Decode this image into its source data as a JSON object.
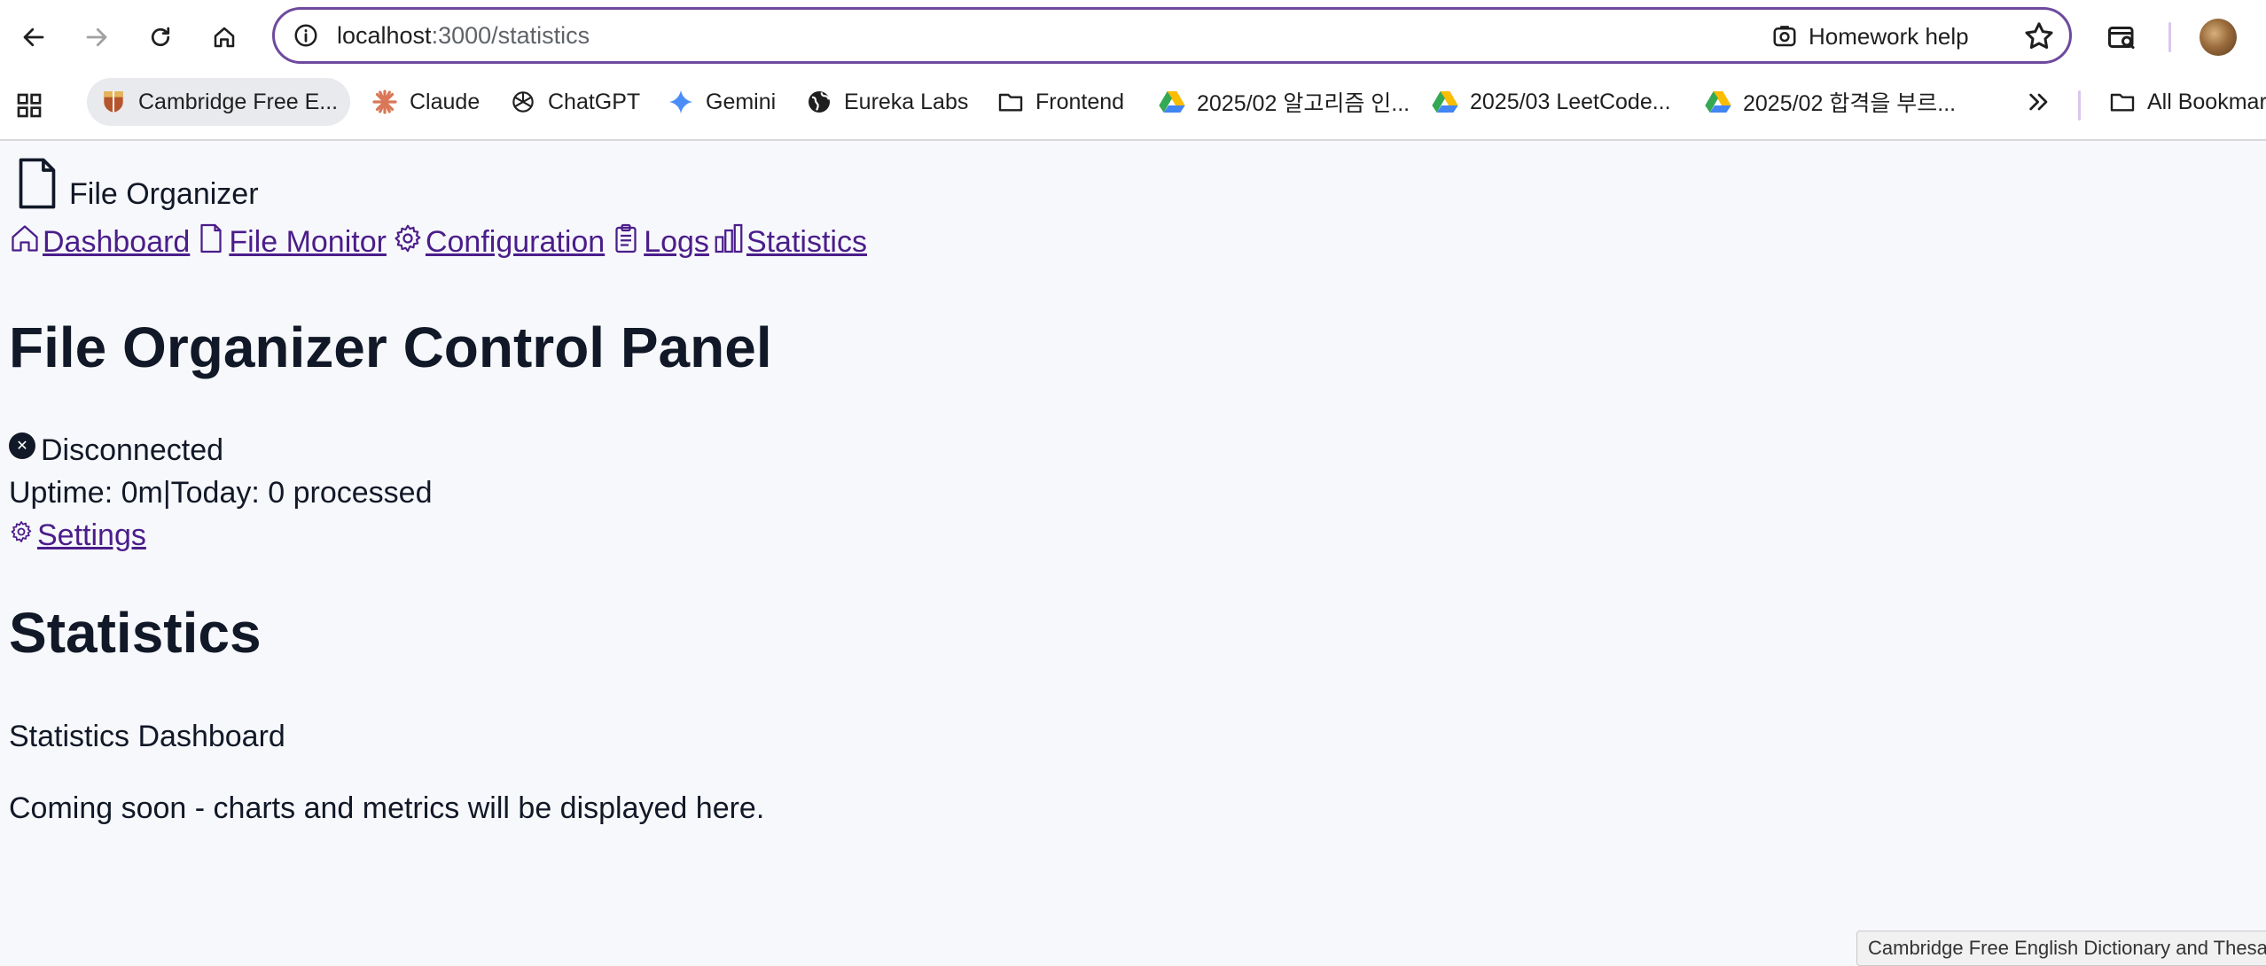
{
  "browser": {
    "url_host": "localhost",
    "url_path": ":3000/statistics",
    "homework_help": "Homework help",
    "bookmarks": [
      {
        "label": "Cambridge Free E...",
        "icon": "cambridge-icon"
      },
      {
        "label": "Claude",
        "icon": "claude-icon"
      },
      {
        "label": "ChatGPT",
        "icon": "chatgpt-icon"
      },
      {
        "label": "Gemini",
        "icon": "gemini-icon"
      },
      {
        "label": "Eureka Labs",
        "icon": "globe-icon"
      },
      {
        "label": "Frontend",
        "icon": "folder-icon"
      },
      {
        "label": "2025/02 알고리즘 인...",
        "icon": "google-drive-icon"
      },
      {
        "label": "2025/03 LeetCode...",
        "icon": "google-drive-icon"
      },
      {
        "label": "2025/02 합격을 부르...",
        "icon": "google-drive-icon"
      }
    ],
    "all_bookmarks": "All Bookmarks",
    "tooltip": "Cambridge Free English Dictionary and Thesaurus"
  },
  "app": {
    "brand": "File Organizer",
    "nav": [
      {
        "label": "Dashboard",
        "icon": "home-icon"
      },
      {
        "label": "File Monitor",
        "icon": "file-icon"
      },
      {
        "label": "Configuration",
        "icon": "gear-icon"
      },
      {
        "label": "Logs",
        "icon": "clipboard-icon"
      },
      {
        "label": "Statistics",
        "icon": "bar-chart-icon"
      }
    ],
    "title": "File Organizer Control Panel",
    "status": "Disconnected",
    "uptime_line": "Uptime: 0m|Today: 0 processed",
    "settings": "Settings",
    "section_title": "Statistics",
    "section_subtitle": "Statistics Dashboard",
    "section_body": "Coming soon - charts and metrics will be displayed here."
  },
  "colors": {
    "accent": "#6e4a9e",
    "link": "#4b1d8a",
    "page_bg": "#f7f8fb",
    "text": "#111827"
  }
}
